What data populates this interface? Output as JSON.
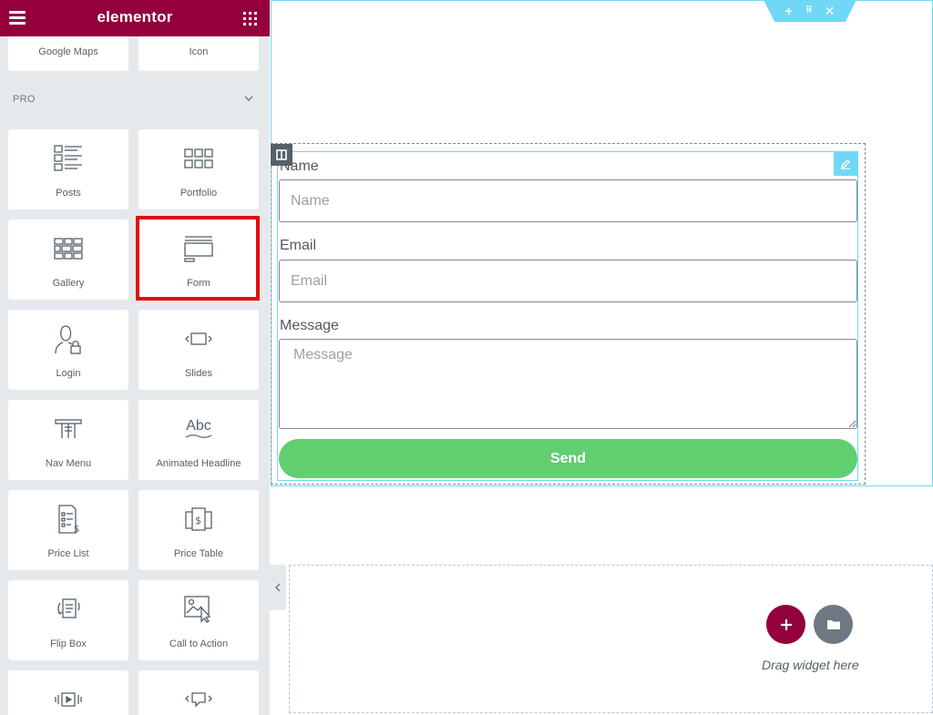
{
  "app": {
    "logo": "elementor"
  },
  "sidebar": {
    "section_label": "PRO",
    "top_widgets": [
      {
        "label": "Google Maps",
        "icon": "map-icon"
      },
      {
        "label": "Icon",
        "icon": "star-icon"
      }
    ],
    "pro_widgets": [
      {
        "label": "Posts",
        "icon": "posts-icon"
      },
      {
        "label": "Portfolio",
        "icon": "portfolio-icon"
      },
      {
        "label": "Gallery",
        "icon": "gallery-icon"
      },
      {
        "label": "Form",
        "icon": "form-icon",
        "selected": true
      },
      {
        "label": "Login",
        "icon": "login-icon"
      },
      {
        "label": "Slides",
        "icon": "slides-icon"
      },
      {
        "label": "Nav Menu",
        "icon": "nav-menu-icon"
      },
      {
        "label": "Animated Headline",
        "icon": "animated-headline-icon"
      },
      {
        "label": "Price List",
        "icon": "price-list-icon"
      },
      {
        "label": "Price Table",
        "icon": "price-table-icon"
      },
      {
        "label": "Flip Box",
        "icon": "flip-box-icon"
      },
      {
        "label": "Call to Action",
        "icon": "call-to-action-icon"
      },
      {
        "label": "",
        "icon": "media-carousel-icon"
      },
      {
        "label": "",
        "icon": "testimonial-carousel-icon"
      }
    ],
    "icon_glyphs": {
      "abc": "Abc",
      "dollar": "$"
    }
  },
  "form": {
    "fields": {
      "name": {
        "label": "Name",
        "placeholder": "Name"
      },
      "email": {
        "label": "Email",
        "placeholder": "Email"
      },
      "message": {
        "label": "Message",
        "placeholder": "Message"
      }
    },
    "submit_label": "Send"
  },
  "canvas": {
    "drop_text": "Drag widget here"
  },
  "colors": {
    "brand": "#93003c",
    "editor_blue": "#71d7f7",
    "send_green": "#61ce70",
    "highlight_red": "#e20b0b",
    "panel_bg": "#e6e9ec"
  }
}
